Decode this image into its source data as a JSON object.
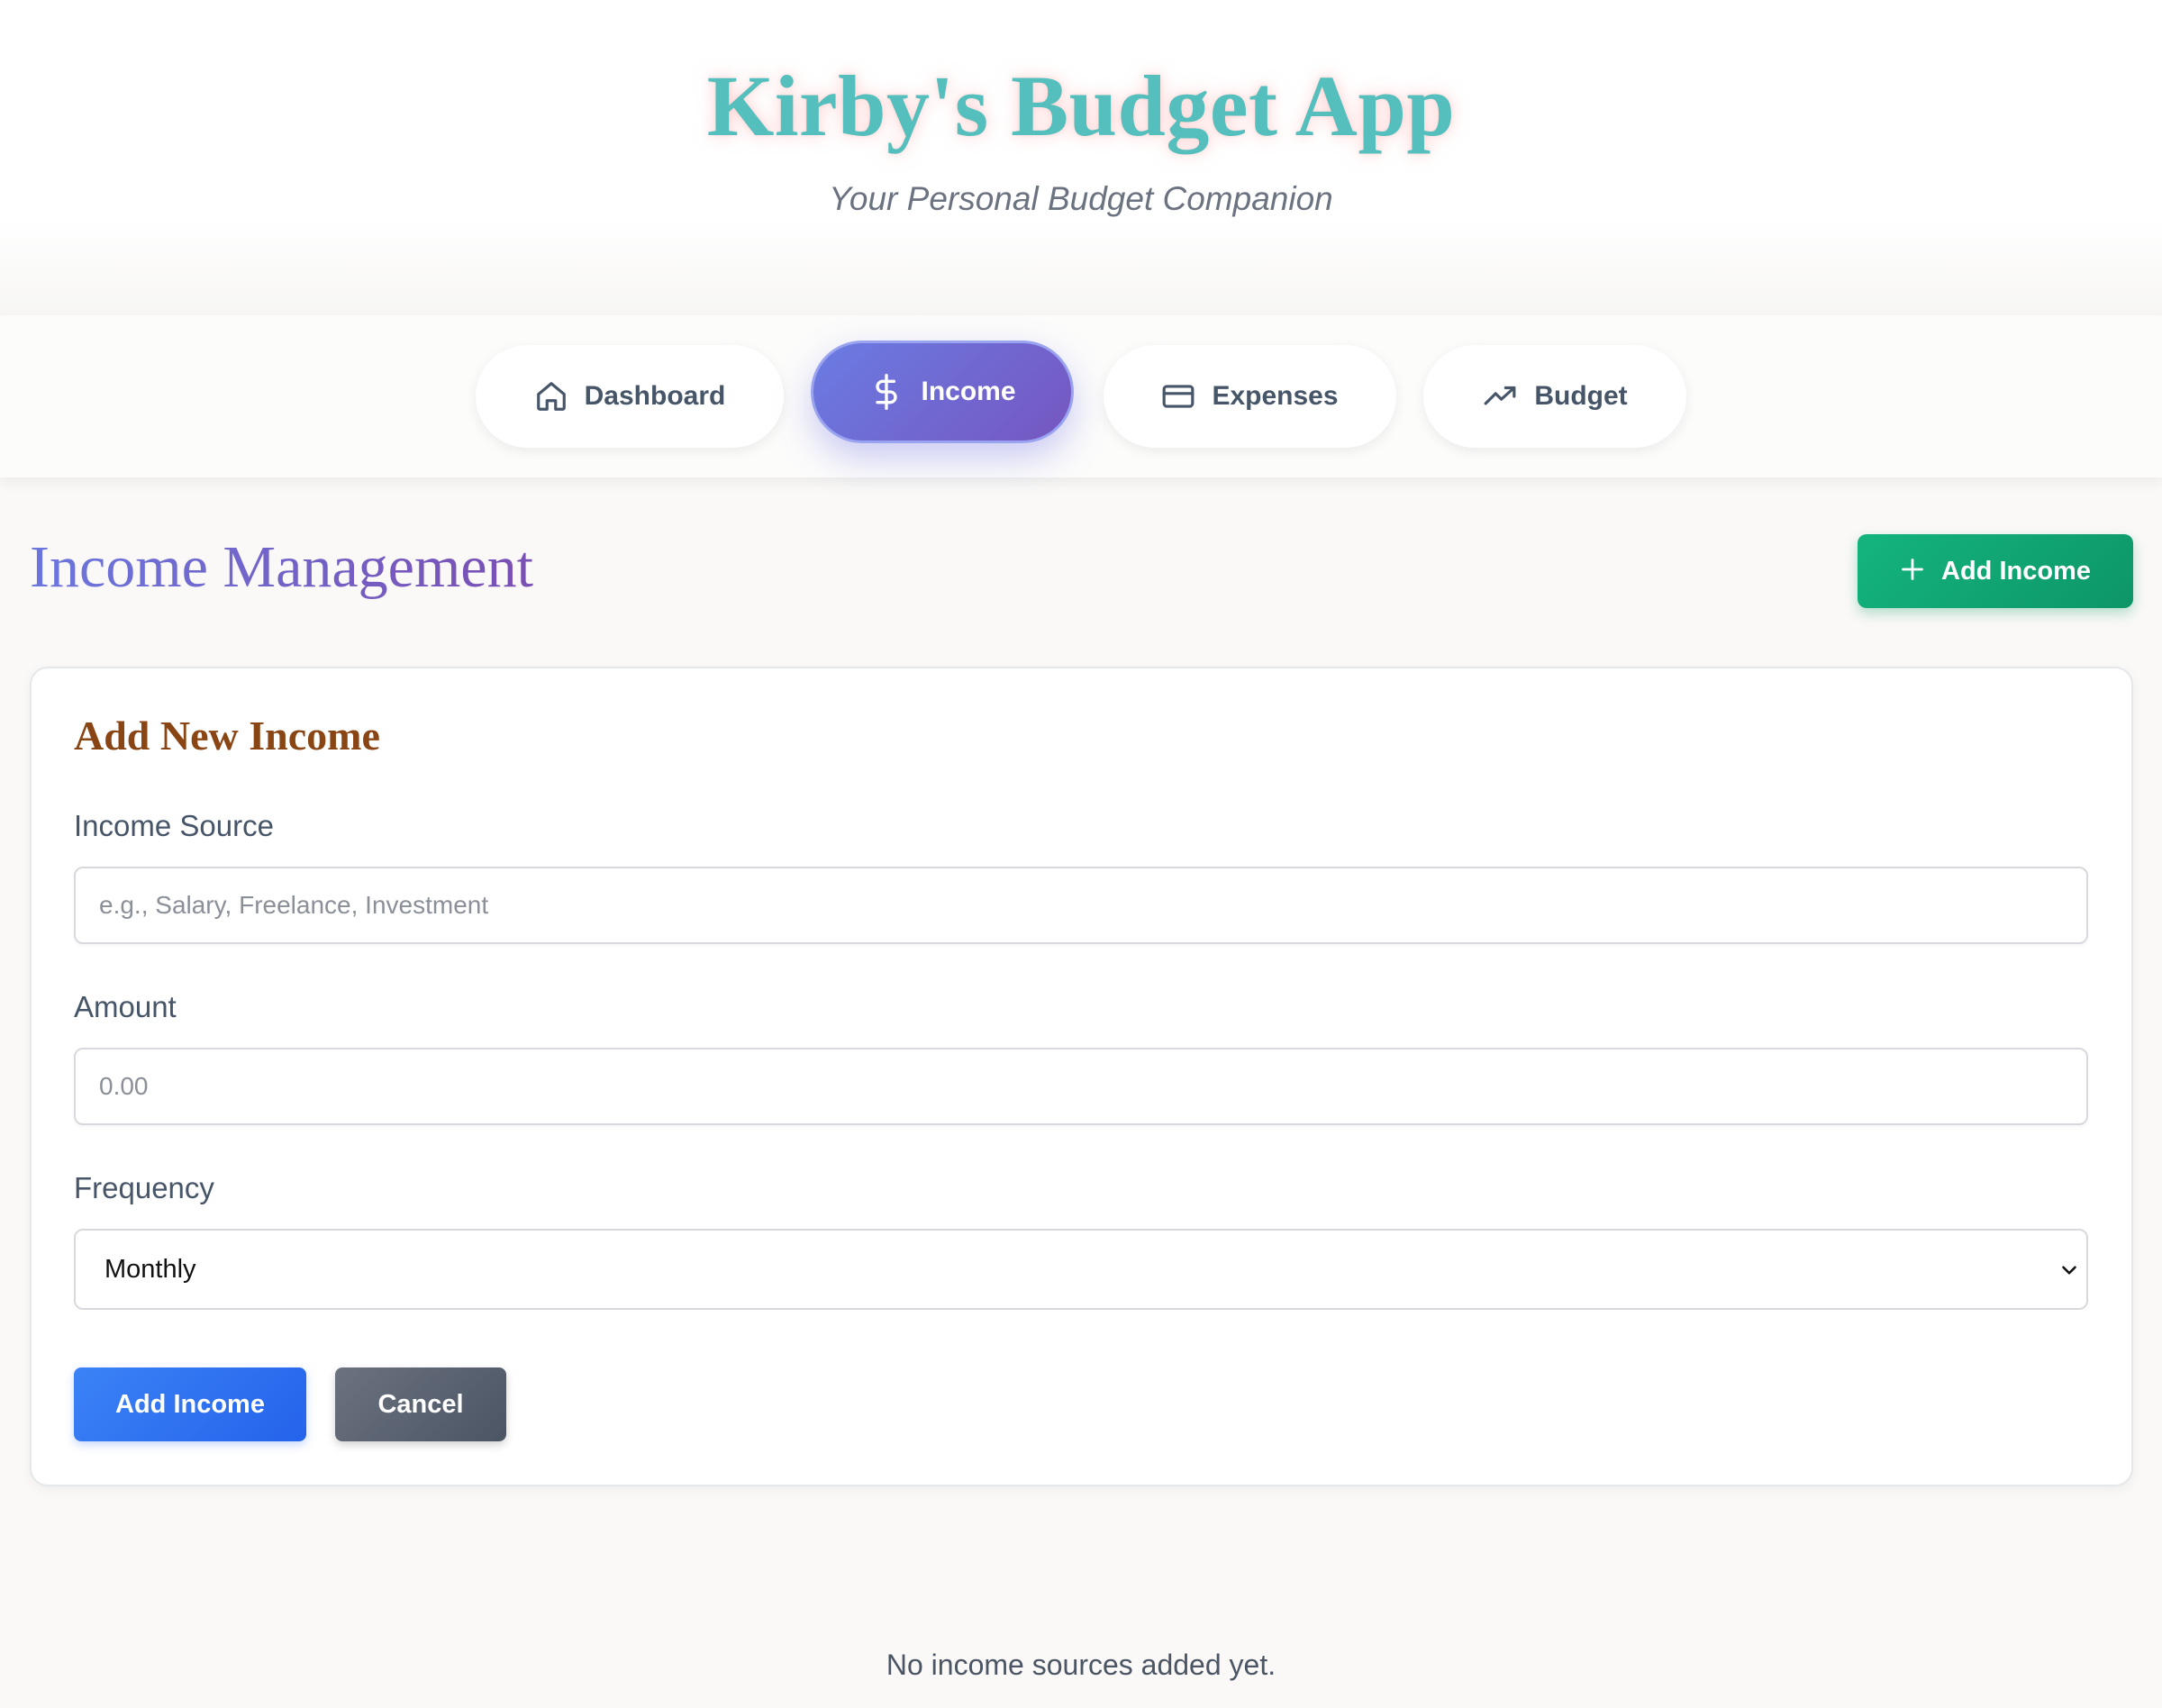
{
  "app": {
    "title": "Kirby's Budget App",
    "subtitle": "Your Personal Budget Companion",
    "title_color": "#55bfbd"
  },
  "nav": {
    "items": [
      {
        "label": "Dashboard",
        "icon": "home-icon",
        "active": false
      },
      {
        "label": "Income",
        "icon": "dollar-icon",
        "active": true
      },
      {
        "label": "Expenses",
        "icon": "credit-card-icon",
        "active": false
      },
      {
        "label": "Budget",
        "icon": "trending-up-icon",
        "active": false
      }
    ]
  },
  "section": {
    "title": "Income Management",
    "add_button_label": "Add Income",
    "add_button_icon": "plus-icon"
  },
  "form": {
    "title": "Add New Income",
    "source": {
      "label": "Income Source",
      "value": "",
      "placeholder": "e.g., Salary, Freelance, Investment"
    },
    "amount": {
      "label": "Amount",
      "value": "",
      "placeholder": "0.00"
    },
    "frequency": {
      "label": "Frequency",
      "selected": "Monthly"
    },
    "submit_label": "Add Income",
    "cancel_label": "Cancel"
  },
  "empty_state": "No income sources added yet.",
  "colors": {
    "accent_purple": "#6a7ce3",
    "accent_green": "#14b47e",
    "primary_blue": "#3b82f6",
    "card_title": "#8a4515"
  }
}
